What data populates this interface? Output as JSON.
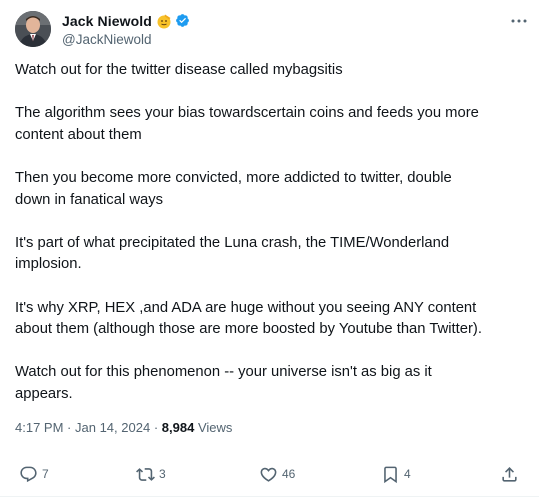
{
  "author": {
    "display_name": "Jack Niewold",
    "handle": "@JackNiewold",
    "emoji": "saluting-face-emoji",
    "verified_color": "#1d9bf0"
  },
  "tweet": {
    "paragraphs": [
      "Watch out for the twitter disease called mybagsitis",
      "The algorithm sees your bias towardscertain coins and feeds you more\ncontent about them",
      "Then you become more convicted, more addicted to twitter, double\ndown in fanatical ways",
      "It's part of what precipitated the Luna crash, the TIME/Wonderland\nimplosion.",
      "It's why XRP, HEX ,and ADA are huge without you seeing ANY content\nabout them (although those are more boosted by Youtube than Twitter).",
      "Watch out for this phenomenon -- your universe isn't as big as it\nappears."
    ],
    "time": "4:17 PM",
    "date": "Jan 14, 2024",
    "views_count": "8,984",
    "views_label": "Views"
  },
  "actions": {
    "replies": "7",
    "reposts": "3",
    "likes": "46",
    "bookmarks": "4"
  },
  "colors": {
    "text": "#0f1419",
    "secondary": "#536471",
    "divider": "#eff3f4"
  }
}
